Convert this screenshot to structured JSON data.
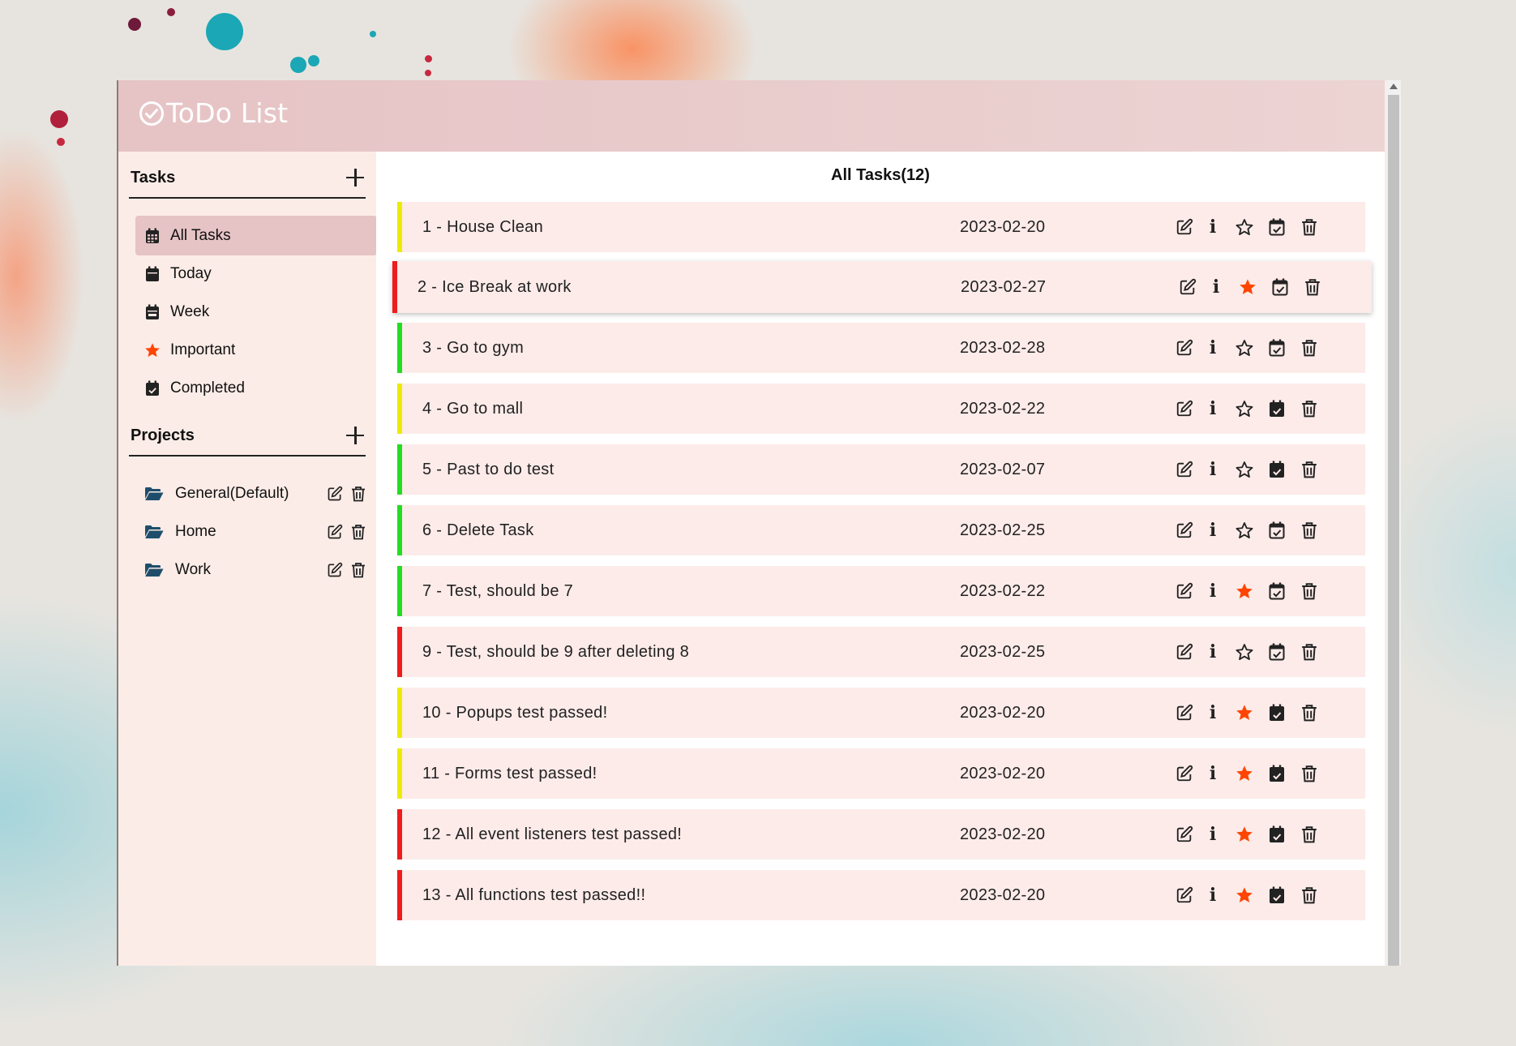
{
  "app": {
    "title": "ToDo List",
    "logo_icon": "check-circle-icon"
  },
  "sidebar": {
    "tasks_heading": "Tasks",
    "projects_heading": "Projects",
    "nav": [
      {
        "label": "All Tasks",
        "icon": "calendar-grid-icon",
        "active": true
      },
      {
        "label": "Today",
        "icon": "calendar-day-icon",
        "active": false
      },
      {
        "label": "Week",
        "icon": "calendar-week-icon",
        "active": false
      },
      {
        "label": "Important",
        "icon": "star-icon",
        "active": false
      },
      {
        "label": "Completed",
        "icon": "calendar-check-icon",
        "active": false
      }
    ],
    "projects": [
      {
        "label": "General(Default)",
        "icon": "folder-open-icon"
      },
      {
        "label": "Home",
        "icon": "folder-open-icon"
      },
      {
        "label": "Work",
        "icon": "folder-open-icon"
      }
    ]
  },
  "main": {
    "heading": "All Tasks(12)",
    "tasks": [
      {
        "title": "1 - House Clean",
        "date": "2023-02-20",
        "priority": "medium",
        "important": false,
        "completed": false
      },
      {
        "title": "2 - Ice Break at work",
        "date": "2023-02-27",
        "priority": "high",
        "important": true,
        "completed": false,
        "hovered": true
      },
      {
        "title": "3 - Go to gym",
        "date": "2023-02-28",
        "priority": "low",
        "important": false,
        "completed": false
      },
      {
        "title": "4 - Go to mall",
        "date": "2023-02-22",
        "priority": "medium",
        "important": false,
        "completed": true
      },
      {
        "title": "5 - Past to do test",
        "date": "2023-02-07",
        "priority": "low",
        "important": false,
        "completed": true
      },
      {
        "title": "6 - Delete Task",
        "date": "2023-02-25",
        "priority": "low",
        "important": false,
        "completed": false
      },
      {
        "title": "7 - Test, should be 7",
        "date": "2023-02-22",
        "priority": "low",
        "important": true,
        "completed": false
      },
      {
        "title": "9 - Test, should be 9 after deleting 8",
        "date": "2023-02-25",
        "priority": "high",
        "important": false,
        "completed": false
      },
      {
        "title": "10 - Popups test passed!",
        "date": "2023-02-20",
        "priority": "medium",
        "important": true,
        "completed": true
      },
      {
        "title": "11 - Forms test passed!",
        "date": "2023-02-20",
        "priority": "medium",
        "important": true,
        "completed": true
      },
      {
        "title": "12 - All event listeners test passed!",
        "date": "2023-02-20",
        "priority": "high",
        "important": true,
        "completed": true
      },
      {
        "title": "13 - All functions test passed!!",
        "date": "2023-02-20",
        "priority": "high",
        "important": true,
        "completed": true
      }
    ]
  },
  "colors": {
    "priority_high": "#ee1c1c",
    "priority_medium": "#ecec00",
    "priority_low": "#22dd22",
    "star_active": "#ff4500",
    "header_bg": "#e6c3c5",
    "sidebar_bg": "#fbece7",
    "task_bg": "#fcebe9"
  }
}
